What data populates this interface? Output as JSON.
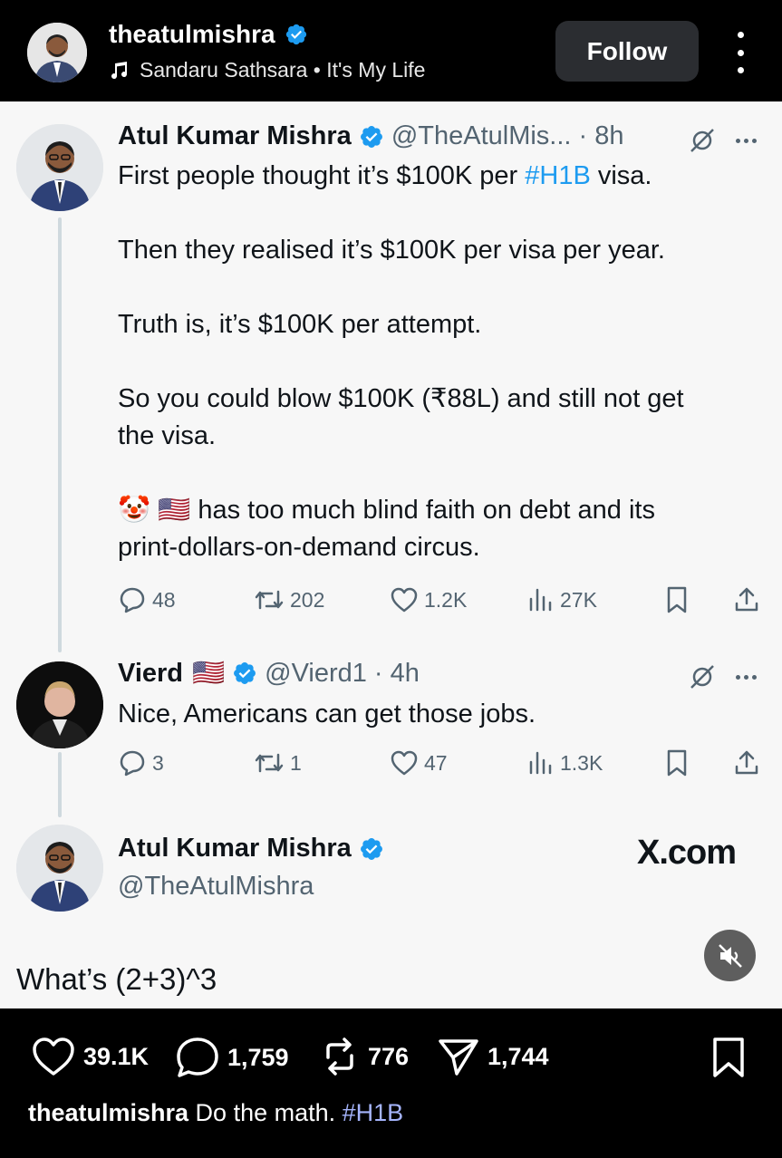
{
  "top": {
    "username": "theatulmishra",
    "music": "Sandaru Sathsara • It's My Life",
    "follow_label": "Follow"
  },
  "tweet1": {
    "name": "Atul Kumar Mishra",
    "meta": "@TheAtulMis... · 8h",
    "line1_pre": "First people thought it’s $100K per ",
    "line1_tag": "#H1B",
    "line1_post": " visa.",
    "line2": "Then they realised it’s $100K per visa per year.",
    "line3": "Truth is, it’s $100K per attempt.",
    "line4a": "So you could blow $100K (₹88L) and still not get",
    "line4b": "the visa.",
    "line5_emoji": "🤡 🇺🇸",
    "line5a": " has too much blind faith on debt and its",
    "line5b": "print-dollars-on-demand circus.",
    "replies": "48",
    "retweets": "202",
    "likes": "1.2K",
    "views": "27K"
  },
  "tweet2": {
    "name": "Vierd",
    "flag": "🇺🇸",
    "meta": "@Vierd1 · 4h",
    "text": "Nice, Americans can get those jobs.",
    "replies": "3",
    "retweets": "1",
    "likes": "47",
    "views": "1.3K"
  },
  "tweet3": {
    "name": "Atul Kumar Mishra",
    "handle": "@TheAtulMishra",
    "site": "X.com"
  },
  "overlay_text": "What’s (2+3)^3",
  "bottom": {
    "likes": "39.1K",
    "comments": "1,759",
    "reposts": "776",
    "shares": "1,744",
    "caption_user": "theatulmishra",
    "caption_text": " Do the math. ",
    "caption_tag": "#H1B"
  },
  "colors": {
    "verified": "#1d9bf0",
    "hashtag": "#1d9bf0",
    "caption_tag": "#a5b4fc"
  }
}
